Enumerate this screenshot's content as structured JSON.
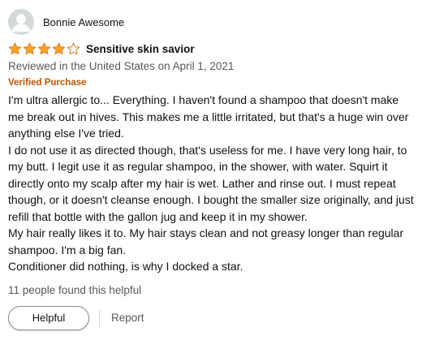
{
  "review": {
    "reviewer_name": "Bonnie Awesome",
    "rating": 4,
    "rating_max": 5,
    "star_color": "#ffa41c",
    "star_empty_color": "#ffffff",
    "star_outline_color": "#de7921",
    "title": "Sensitive skin savior",
    "date_line": "Reviewed in the United States on April 1, 2021",
    "verified_label": "Verified Purchase",
    "verified_color": "#c45500",
    "body_paragraphs": [
      "I'm ultra allergic to... Everything. I haven't found a shampoo that doesn't make me break out in hives. This makes me a little irritated, but that's a huge win over anything else I've tried.",
      "I do not use it as directed though, that's useless for me. I have very long hair, to my butt. I legit use it as regular shampoo, in the shower, with water. Squirt it directly onto my scalp after my hair is wet. Lather and rinse out. I must repeat though, or it doesn't cleanse enough. I bought the smaller size originally, and just refill that bottle with the gallon jug and keep it in my shower.",
      "My hair really likes it to. My hair stays clean and not greasy longer than regular shampoo. I'm a big fan.",
      "Conditioner did nothing, is why I docked a star."
    ],
    "helpful_count_text": "11 people found this helpful",
    "helpful_button_label": "Helpful",
    "report_label": "Report",
    "avatar_icon": "default-user-avatar-icon"
  }
}
